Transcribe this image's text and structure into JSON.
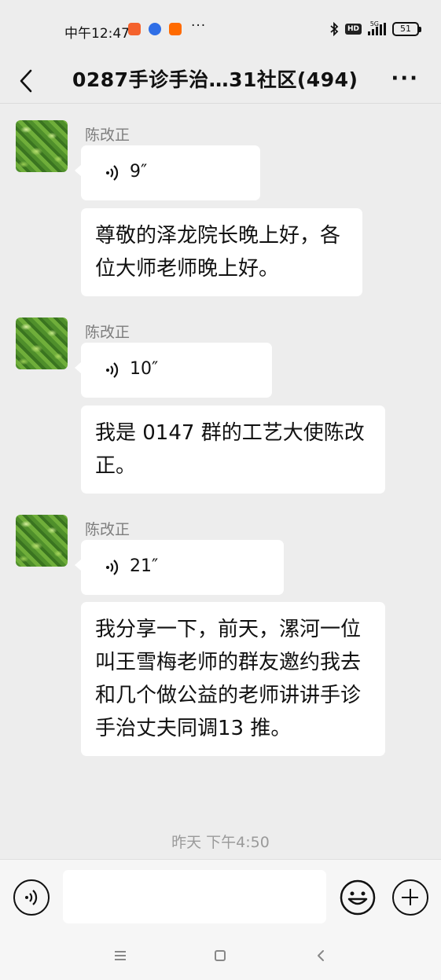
{
  "status_bar": {
    "time": "中午12:47",
    "more": "···",
    "hd": "HD",
    "network": "5G",
    "battery": "51"
  },
  "header": {
    "title": "0287手诊手治…31社区(494)"
  },
  "messages": [
    {
      "sender": "陈改正",
      "voice_duration": "9″",
      "text": "尊敬的泽龙院长晚上好，各位大师老师晚上好。"
    },
    {
      "sender": "陈改正",
      "voice_duration": "10″",
      "text": "我是 0147 群的工艺大使陈改正。"
    },
    {
      "sender": "陈改正",
      "voice_duration": "21″",
      "text": "我分享一下，前天，漯河一位叫王雪梅老师的群友邀约我去和几个做公益的老师讲讲手诊手治丈夫同调13 推。"
    }
  ],
  "timestamp": "昨天 下午4:50",
  "input": {
    "placeholder": ""
  },
  "colors": {
    "background": "#ededed",
    "bubble": "#ffffff",
    "sender_name": "#7d7d7d",
    "timestamp": "#9a9a9a"
  },
  "icons": [
    "back-icon",
    "more-icon",
    "voice-icon",
    "voice-toggle-icon",
    "emoji-icon",
    "plus-icon"
  ]
}
